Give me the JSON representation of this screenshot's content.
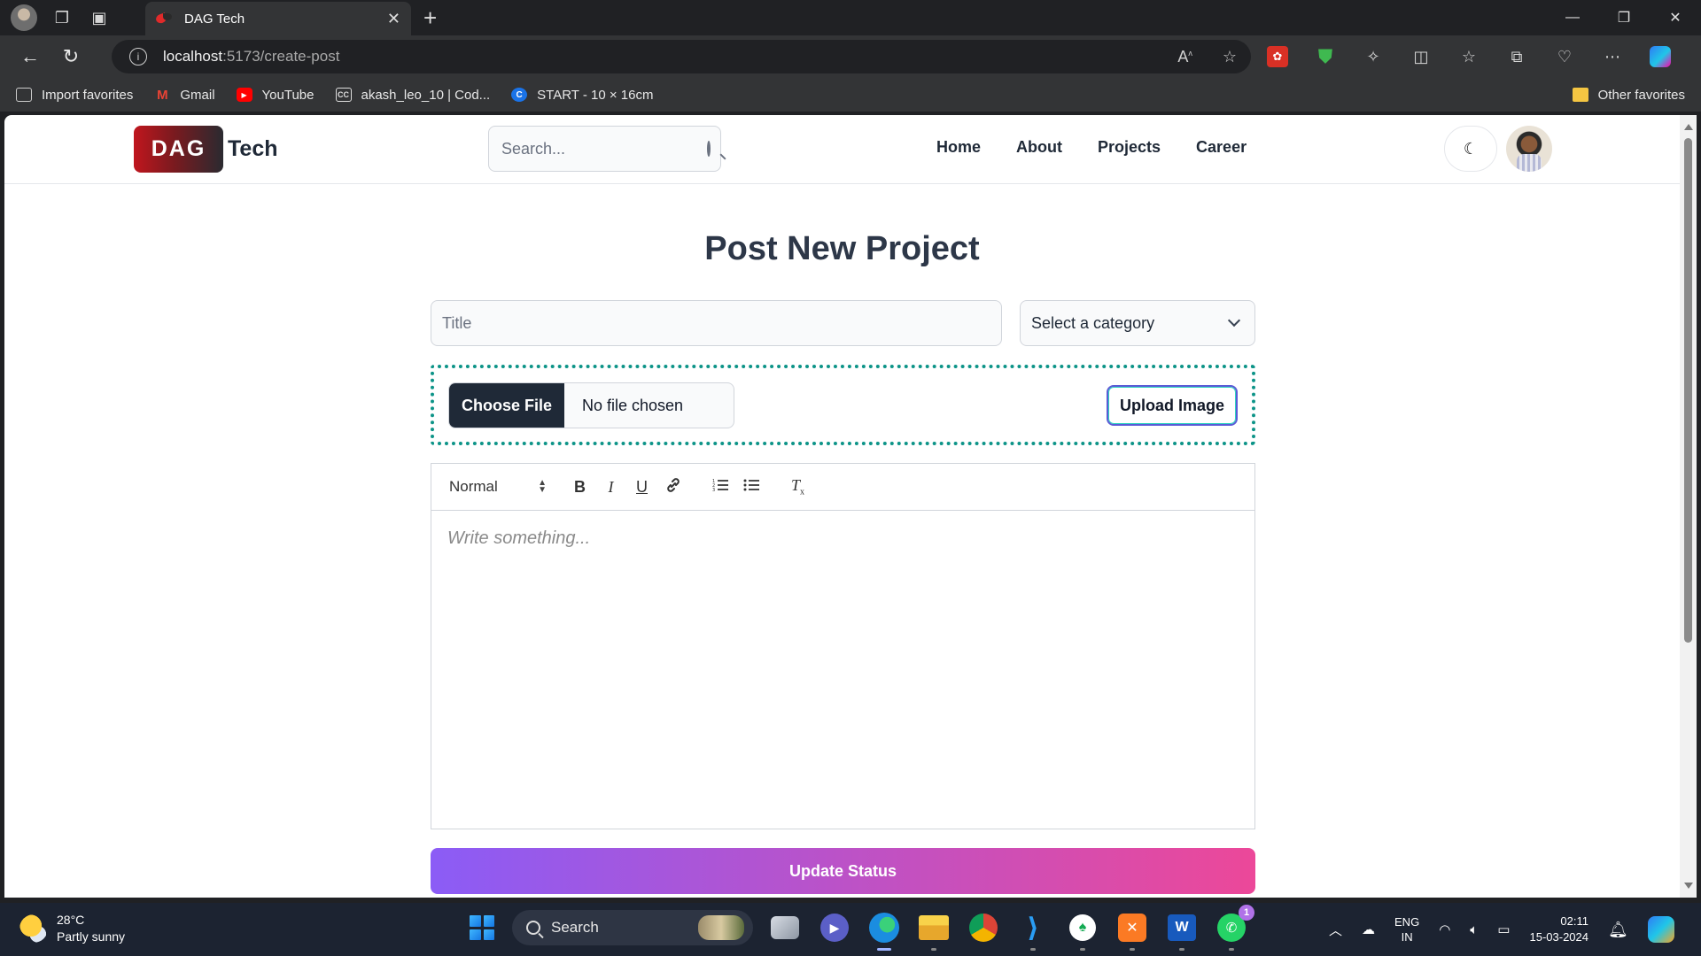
{
  "browser": {
    "tab_title": "DAG Tech",
    "url_host": "localhost",
    "url_path": ":5173/create-post",
    "bookmarks": [
      {
        "label": "Import favorites",
        "icon": "import-icon"
      },
      {
        "label": "Gmail",
        "icon": "gmail-icon"
      },
      {
        "label": "YouTube",
        "icon": "youtube-icon"
      },
      {
        "label": "akash_leo_10 | Cod...",
        "icon": "codechef-icon"
      },
      {
        "label": "START - 10 × 16cm",
        "icon": "start-icon"
      }
    ],
    "other_favorites": "Other favorites"
  },
  "site": {
    "logo_badge": "DAG",
    "logo_text": "Tech",
    "search_placeholder": "Search...",
    "nav": [
      "Home",
      "About",
      "Projects",
      "Career"
    ],
    "theme_icon": "☾"
  },
  "form": {
    "heading": "Post New Project",
    "title_placeholder": "Title",
    "category_value": "Select a category",
    "choose_file_label": "Choose File",
    "file_status": "No file chosen",
    "upload_button": "Upload Image",
    "editor": {
      "format_select": "Normal",
      "tools": [
        "B",
        "I",
        "U",
        "link",
        "ordered-list",
        "bullet-list",
        "clean"
      ],
      "placeholder": "Write something..."
    },
    "submit_label": "Update Status"
  },
  "taskbar": {
    "temperature": "28°C",
    "weather": "Partly sunny",
    "search_label": "Search",
    "whatsapp_badge": "1",
    "lang_top": "ENG",
    "lang_bottom": "IN",
    "time": "02:11",
    "date": "15-03-2024"
  },
  "colors": {
    "accent_teal": "#0d9488",
    "submit_gradient_start": "#8b5cf6",
    "submit_gradient_end": "#ec4899",
    "logo_red": "#c0161e"
  }
}
